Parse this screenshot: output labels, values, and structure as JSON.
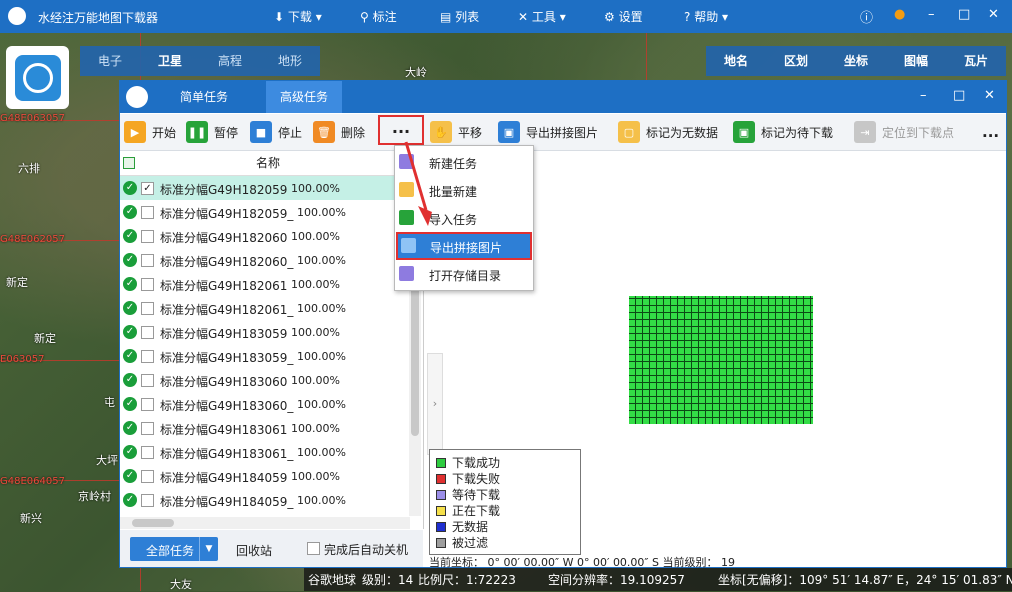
{
  "app": {
    "title": "水经注万能地图下载器"
  },
  "menu": {
    "download": "下载",
    "mark": "标注",
    "list": "列表",
    "tools": "工具",
    "settings": "设置",
    "help": "帮助"
  },
  "map_tabs": [
    "电子",
    "卫星",
    "高程",
    "地形"
  ],
  "right_tabs": [
    "地名",
    "区划",
    "坐标",
    "图幅",
    "瓦片"
  ],
  "map_labels": [
    "大岭",
    "六排",
    "新定",
    "新定",
    "大坪",
    "京岭村",
    "新兴",
    "大友",
    "屯"
  ],
  "map_red_labels": [
    "G48E063057",
    "G48E062057",
    "E063057",
    "G48E064057"
  ],
  "task_window": {
    "tabs": [
      "简单任务",
      "高级任务"
    ],
    "active_tab": "高级任务"
  },
  "toolbar": {
    "start": "开始",
    "pause": "暂停",
    "stop": "停止",
    "delete": "删除",
    "more": "...",
    "pan": "平移",
    "export_mosaic": "导出拼接图片",
    "mark_nodata": "标记为无数据",
    "mark_pending": "标记为待下载",
    "locate": "定位到下载点",
    "overflow": "..."
  },
  "list": {
    "header": "名称",
    "rows": [
      {
        "name": "标准分幅G49H182059",
        "progress": "100.00%",
        "checked": true,
        "selected": true
      },
      {
        "name": "标准分幅G49H182059_",
        "progress": "100.00%",
        "checked": false,
        "selected": false
      },
      {
        "name": "标准分幅G49H182060",
        "progress": "100.00%",
        "checked": false,
        "selected": false
      },
      {
        "name": "标准分幅G49H182060_",
        "progress": "100.00%",
        "checked": false,
        "selected": false
      },
      {
        "name": "标准分幅G49H182061",
        "progress": "100.00%",
        "checked": false,
        "selected": false
      },
      {
        "name": "标准分幅G49H182061_",
        "progress": "100.00%",
        "checked": false,
        "selected": false
      },
      {
        "name": "标准分幅G49H183059",
        "progress": "100.00%",
        "checked": false,
        "selected": false
      },
      {
        "name": "标准分幅G49H183059_",
        "progress": "100.00%",
        "checked": false,
        "selected": false
      },
      {
        "name": "标准分幅G49H183060",
        "progress": "100.00%",
        "checked": false,
        "selected": false
      },
      {
        "name": "标准分幅G49H183060_",
        "progress": "100.00%",
        "checked": false,
        "selected": false
      },
      {
        "name": "标准分幅G49H183061",
        "progress": "100.00%",
        "checked": false,
        "selected": false
      },
      {
        "name": "标准分幅G49H183061_",
        "progress": "100.00%",
        "checked": false,
        "selected": false
      },
      {
        "name": "标准分幅G49H184059",
        "progress": "100.00%",
        "checked": false,
        "selected": false
      },
      {
        "name": "标准分幅G49H184059_",
        "progress": "100.00%",
        "checked": false,
        "selected": false
      }
    ]
  },
  "bottom": {
    "all_tasks": "全部任务",
    "recycle": "回收站",
    "auto_shutdown": "完成后自动关机"
  },
  "dropdown": {
    "items": [
      "新建任务",
      "批量新建",
      "导入任务",
      "导出拼接图片",
      "打开存储目录"
    ],
    "highlighted_index": 3
  },
  "legend": {
    "items": [
      {
        "label": "下载成功",
        "color": "#2ecc40"
      },
      {
        "label": "下载失败",
        "color": "#e03030"
      },
      {
        "label": "等待下载",
        "color": "#9b8ee8"
      },
      {
        "label": "正在下载",
        "color": "#f5e04a"
      },
      {
        "label": "无数据",
        "color": "#1f2fd0"
      },
      {
        "label": "被过滤",
        "color": "#9e9e9e"
      }
    ]
  },
  "coord_line": "当前坐标：  0° 00′ 00.00″ W 0° 00′ 00.00″ S   当前级别： 19",
  "status": {
    "source": "谷歌地球",
    "level": "级别：14",
    "scale": "比例尺：1:72223",
    "resolution": "空间分辨率：19.109257",
    "coord": "坐标[无偏移]：109° 51′ 14.87″ E，24° 15′ 01.83″ N"
  },
  "colors": {
    "primary": "#1e6fc4",
    "highlight": "#e03030",
    "success": "#1a9e3a"
  }
}
